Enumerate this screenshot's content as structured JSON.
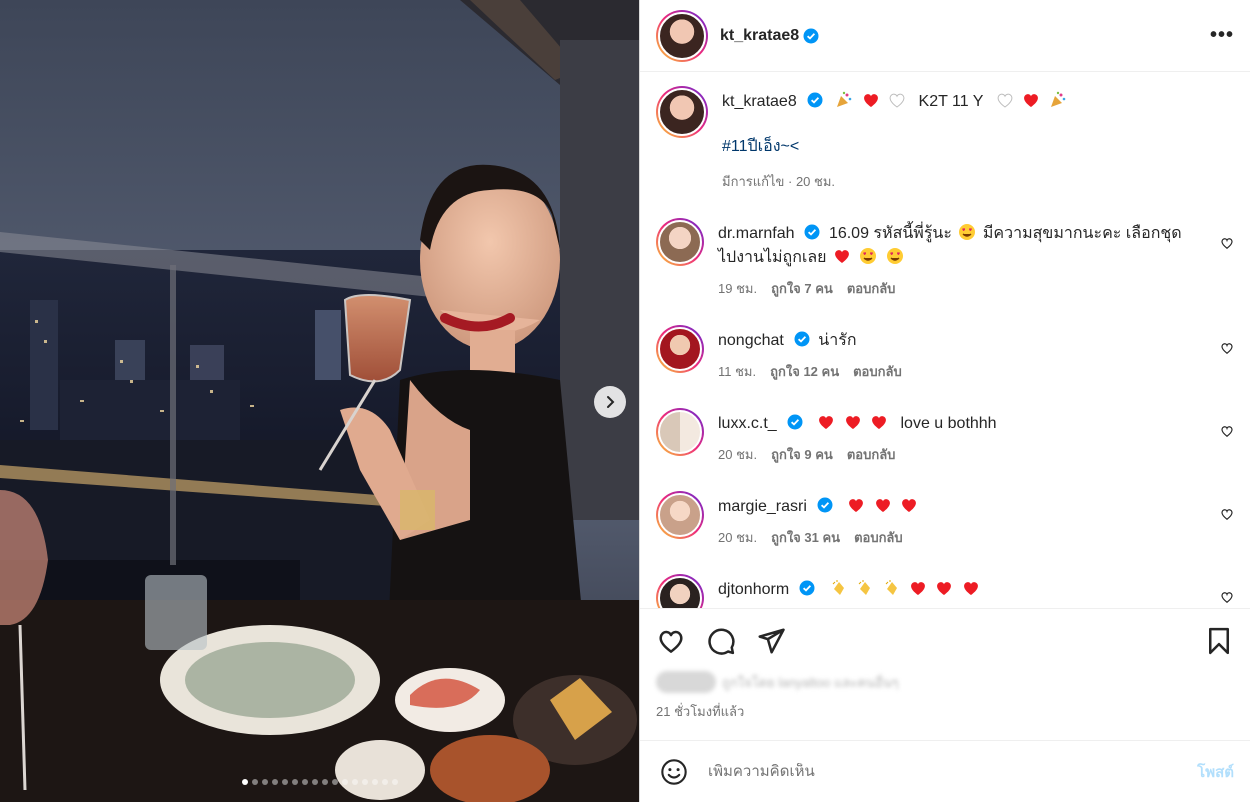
{
  "post": {
    "author": "kt_kratae8",
    "more_label": "•••",
    "carousel": {
      "slides": 16,
      "active": 0
    }
  },
  "caption": {
    "username": "kt_kratae8",
    "text": "K2T 11 Y",
    "hashtag": "#11ปีเอ็ง~<",
    "meta": "มีการแก้ไข · 20 ชม."
  },
  "comments": [
    {
      "username": "dr.marnfah",
      "text_a": "16.09 รหัสนี้พี่รู้นะ",
      "text_b": "มีความสุขมากนะคะ เลือกชุด ไปงานไม่ถูกเลย",
      "time": "19 ชม.",
      "likes": "ถูกใจ 7 คน",
      "reply": "ตอบกลับ"
    },
    {
      "username": "nongchat",
      "text_a": "น่ารัก",
      "time": "11 ชม.",
      "likes": "ถูกใจ 12 คน",
      "reply": "ตอบกลับ"
    },
    {
      "username": "luxx.c.t_",
      "text_a": "love u bothhh",
      "time": "20 ชม.",
      "likes": "ถูกใจ 9 คน",
      "reply": "ตอบกลับ"
    },
    {
      "username": "margie_rasri",
      "time": "20 ชม.",
      "likes": "ถูกใจ 31 คน",
      "reply": "ตอบกลับ"
    },
    {
      "username": "djtonhorm"
    }
  ],
  "footer": {
    "liked_by_text": "ถูกใจโดย lanyaltoo และคนอื่นๆ",
    "time_ago": "21 ชั่วโมงที่แล้ว",
    "comment_placeholder": "เพิ่มความคิดเห็น",
    "post_label": "โพสต์"
  },
  "colors": {
    "verified": "#0095f6",
    "heart_red": "#ed1c24",
    "link": "#00376b",
    "post_btn_disabled": "#b2dffc"
  }
}
